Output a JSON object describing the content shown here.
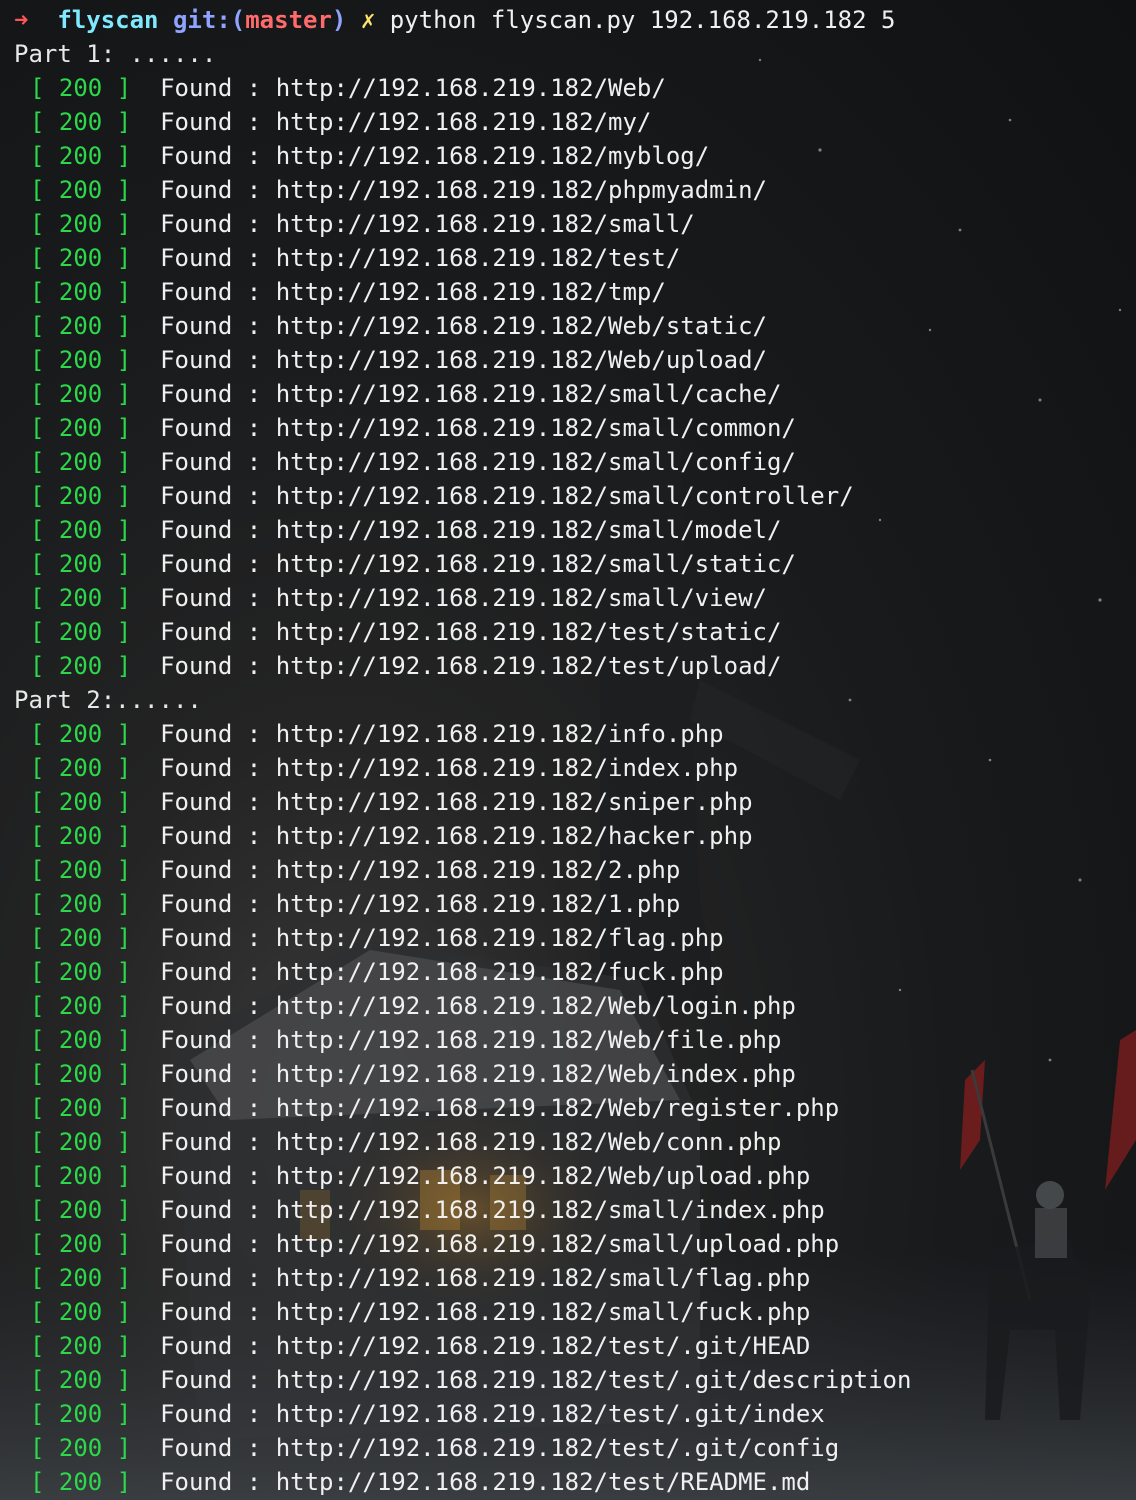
{
  "prompt": {
    "arrow": "➜",
    "directory": "flyscan",
    "git_label": "git:(",
    "branch": "master",
    "git_close": ")",
    "dirty_mark": "✗",
    "command": "python flyscan.py 192.168.219.182 5"
  },
  "colors": {
    "status_green": "#2bd94a",
    "dir_cyan": "#7fe9ff",
    "git_blue": "#8fa3ff",
    "branch_red": "#ff6b6b",
    "dirty_yellow": "#ffe46b",
    "text": "#f0f0f0"
  },
  "parts": [
    {
      "label": "Part 1: ......",
      "results": [
        {
          "status": "200",
          "found": "Found",
          "url": "http://192.168.219.182/Web/"
        },
        {
          "status": "200",
          "found": "Found",
          "url": "http://192.168.219.182/my/"
        },
        {
          "status": "200",
          "found": "Found",
          "url": "http://192.168.219.182/myblog/"
        },
        {
          "status": "200",
          "found": "Found",
          "url": "http://192.168.219.182/phpmyadmin/"
        },
        {
          "status": "200",
          "found": "Found",
          "url": "http://192.168.219.182/small/"
        },
        {
          "status": "200",
          "found": "Found",
          "url": "http://192.168.219.182/test/"
        },
        {
          "status": "200",
          "found": "Found",
          "url": "http://192.168.219.182/tmp/"
        },
        {
          "status": "200",
          "found": "Found",
          "url": "http://192.168.219.182/Web/static/"
        },
        {
          "status": "200",
          "found": "Found",
          "url": "http://192.168.219.182/Web/upload/"
        },
        {
          "status": "200",
          "found": "Found",
          "url": "http://192.168.219.182/small/cache/"
        },
        {
          "status": "200",
          "found": "Found",
          "url": "http://192.168.219.182/small/common/"
        },
        {
          "status": "200",
          "found": "Found",
          "url": "http://192.168.219.182/small/config/"
        },
        {
          "status": "200",
          "found": "Found",
          "url": "http://192.168.219.182/small/controller/"
        },
        {
          "status": "200",
          "found": "Found",
          "url": "http://192.168.219.182/small/model/"
        },
        {
          "status": "200",
          "found": "Found",
          "url": "http://192.168.219.182/small/static/"
        },
        {
          "status": "200",
          "found": "Found",
          "url": "http://192.168.219.182/small/view/"
        },
        {
          "status": "200",
          "found": "Found",
          "url": "http://192.168.219.182/test/static/"
        },
        {
          "status": "200",
          "found": "Found",
          "url": "http://192.168.219.182/test/upload/"
        }
      ]
    },
    {
      "label": "Part 2:......",
      "results": [
        {
          "status": "200",
          "found": "Found",
          "url": "http://192.168.219.182/info.php"
        },
        {
          "status": "200",
          "found": "Found",
          "url": "http://192.168.219.182/index.php"
        },
        {
          "status": "200",
          "found": "Found",
          "url": "http://192.168.219.182/sniper.php"
        },
        {
          "status": "200",
          "found": "Found",
          "url": "http://192.168.219.182/hacker.php"
        },
        {
          "status": "200",
          "found": "Found",
          "url": "http://192.168.219.182/2.php"
        },
        {
          "status": "200",
          "found": "Found",
          "url": "http://192.168.219.182/1.php"
        },
        {
          "status": "200",
          "found": "Found",
          "url": "http://192.168.219.182/flag.php"
        },
        {
          "status": "200",
          "found": "Found",
          "url": "http://192.168.219.182/fuck.php"
        },
        {
          "status": "200",
          "found": "Found",
          "url": "http://192.168.219.182/Web/login.php"
        },
        {
          "status": "200",
          "found": "Found",
          "url": "http://192.168.219.182/Web/file.php"
        },
        {
          "status": "200",
          "found": "Found",
          "url": "http://192.168.219.182/Web/index.php"
        },
        {
          "status": "200",
          "found": "Found",
          "url": "http://192.168.219.182/Web/register.php"
        },
        {
          "status": "200",
          "found": "Found",
          "url": "http://192.168.219.182/Web/conn.php"
        },
        {
          "status": "200",
          "found": "Found",
          "url": "http://192.168.219.182/Web/upload.php"
        },
        {
          "status": "200",
          "found": "Found",
          "url": "http://192.168.219.182/small/index.php"
        },
        {
          "status": "200",
          "found": "Found",
          "url": "http://192.168.219.182/small/upload.php"
        },
        {
          "status": "200",
          "found": "Found",
          "url": "http://192.168.219.182/small/flag.php"
        },
        {
          "status": "200",
          "found": "Found",
          "url": "http://192.168.219.182/small/fuck.php"
        },
        {
          "status": "200",
          "found": "Found",
          "url": "http://192.168.219.182/test/.git/HEAD"
        },
        {
          "status": "200",
          "found": "Found",
          "url": "http://192.168.219.182/test/.git/description"
        },
        {
          "status": "200",
          "found": "Found",
          "url": "http://192.168.219.182/test/.git/index"
        },
        {
          "status": "200",
          "found": "Found",
          "url": "http://192.168.219.182/test/.git/config"
        },
        {
          "status": "200",
          "found": "Found",
          "url": "http://192.168.219.182/test/README.md"
        }
      ]
    }
  ]
}
